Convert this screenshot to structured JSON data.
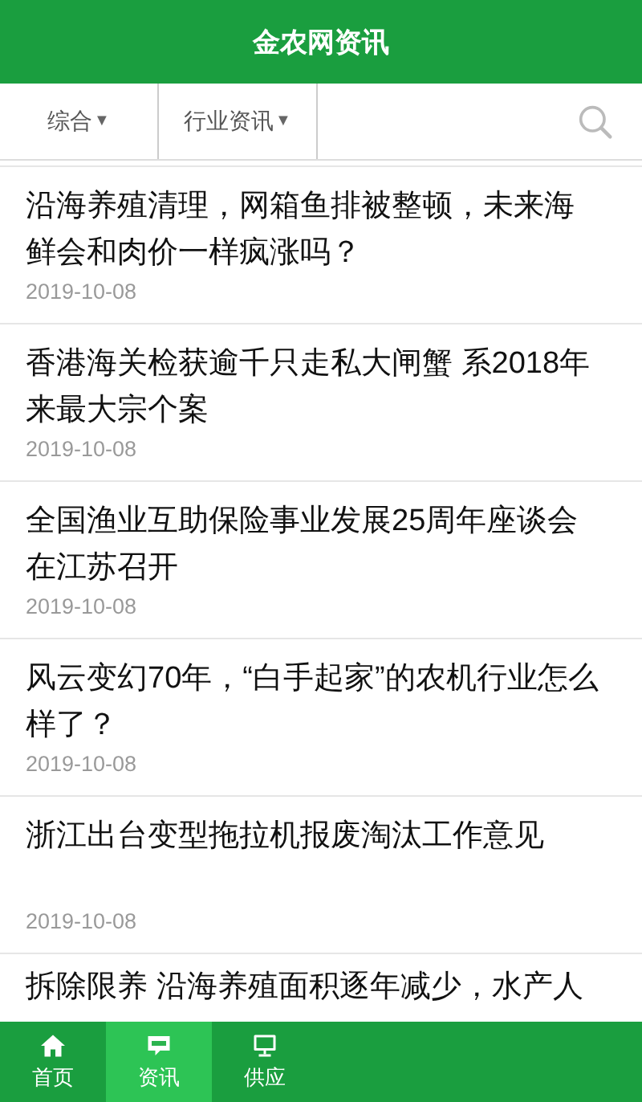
{
  "header": {
    "title": "金农网资讯"
  },
  "filters": [
    {
      "label": "综合",
      "icon": "▼"
    },
    {
      "label": "行业资讯",
      "icon": "▼"
    }
  ],
  "articles": [
    {
      "title": "沿海养殖清理，网箱鱼排被整顿，未来海鲜会和肉价一样疯涨吗？",
      "date": "2019-10-08"
    },
    {
      "title": "香港海关检获逾千只走私大闸蟹 系2018年来最大宗个案",
      "date": "2019-10-08"
    },
    {
      "title": "全国渔业互助保险事业发展25周年座谈会在江苏召开",
      "date": "2019-10-08"
    },
    {
      "title": "风云变幻70年，“白手起家”的农机行业怎么样了？",
      "date": "2019-10-08"
    },
    {
      "title": "浙江出台变型拖拉机报废淘汰工作意见",
      "date": "2019-10-08"
    },
    {
      "title": "拆除限养 沿海养殖面积逐年减少，水产人"
    }
  ],
  "tabbar": [
    {
      "label": "首页",
      "selected": false
    },
    {
      "label": "资讯",
      "selected": true
    },
    {
      "label": "供应",
      "selected": false
    }
  ]
}
